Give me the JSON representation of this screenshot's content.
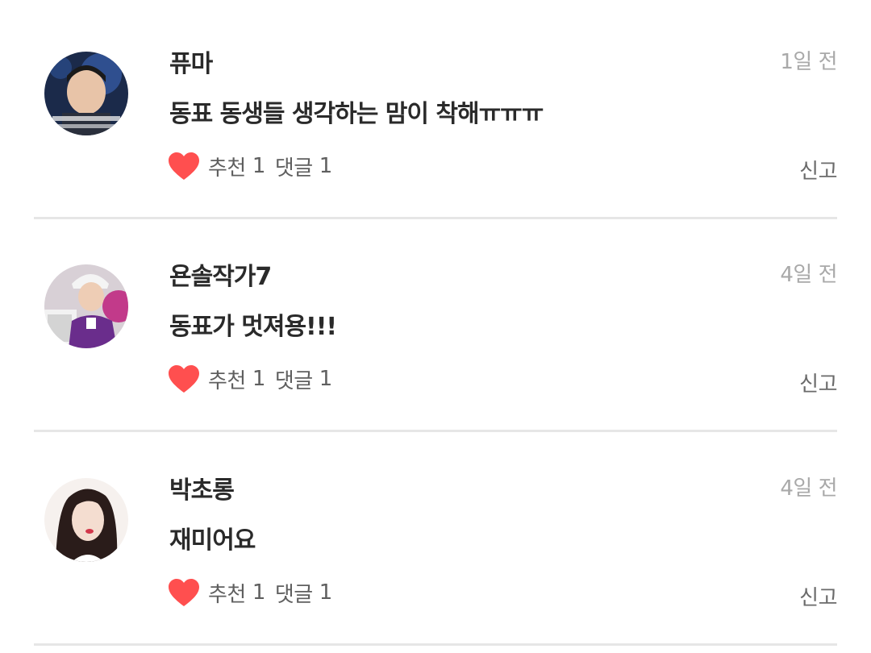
{
  "comments": [
    {
      "author": "퓨마",
      "time": "1일 전",
      "text": "동표 동생들 생각하는 맘이 착해ㅠㅠㅠ",
      "like_label": "추천",
      "like_count": "1",
      "reply_label": "댓글",
      "reply_count": "1",
      "report_label": "신고"
    },
    {
      "author": "욘솔작가7",
      "time": "4일 전",
      "text": "동표가 멋져용!!!",
      "like_label": "추천",
      "like_count": "1",
      "reply_label": "댓글",
      "reply_count": "1",
      "report_label": "신고"
    },
    {
      "author": "박초롱",
      "time": "4일 전",
      "text": "재미어요",
      "like_label": "추천",
      "like_count": "1",
      "reply_label": "댓글",
      "reply_count": "1",
      "report_label": "신고"
    }
  ],
  "colors": {
    "heart": "#ff4f4f",
    "divider": "#e6e6e6",
    "time_text": "#a9a9a9"
  },
  "icons": {
    "like": "heart-icon"
  }
}
